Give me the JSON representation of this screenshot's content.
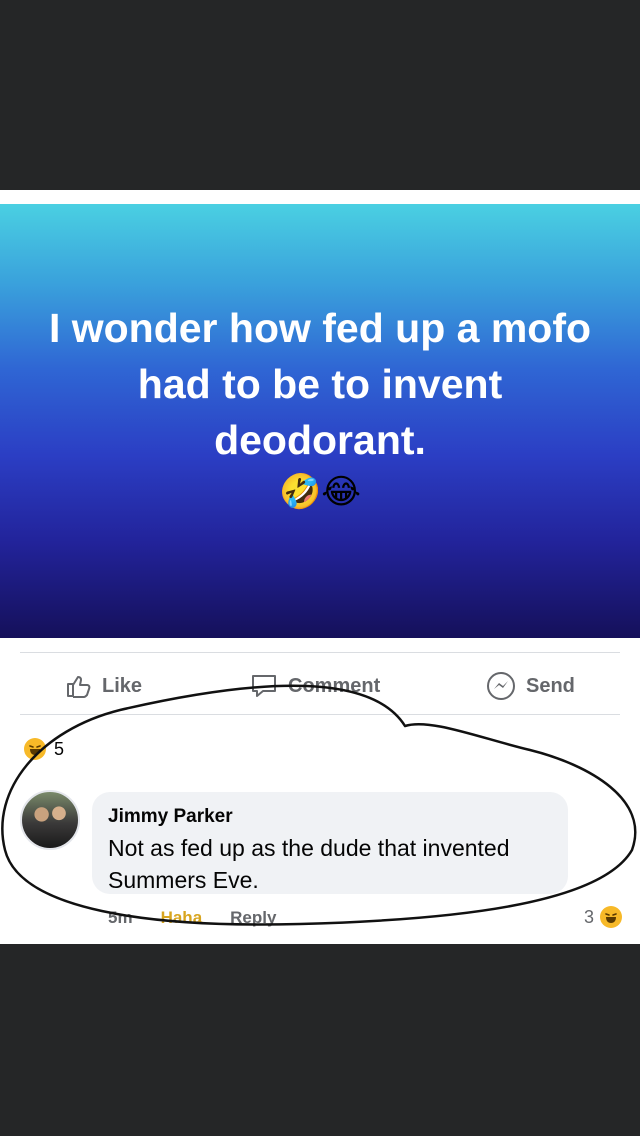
{
  "status": {
    "text": "I wonder how fed up a mofo had to be to invent deodorant.",
    "emoji": "🤣😂"
  },
  "actions": {
    "like_label": "Like",
    "comment_label": "Comment",
    "send_label": "Send"
  },
  "reactions": {
    "count": "5"
  },
  "comment": {
    "author": "Jimmy Parker",
    "text": "Not as fed up as the dude that invented Summers Eve.",
    "time": "5m",
    "haha_label": "Haha",
    "reply_label": "Reply",
    "reaction_count": "3"
  },
  "colors": {
    "background": "#242526",
    "haha": "#f7b928",
    "meta_text": "#65676b"
  }
}
